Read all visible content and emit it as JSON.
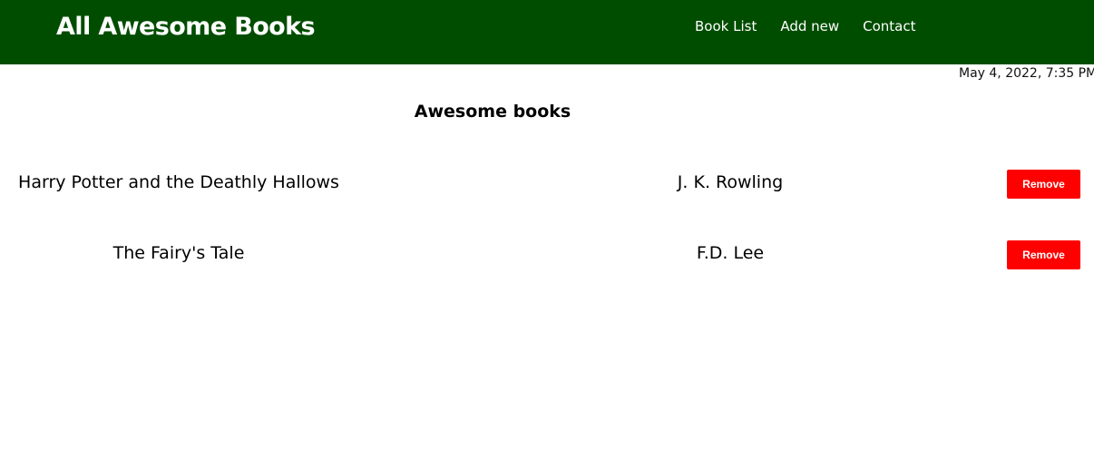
{
  "header": {
    "brand": "All Awesome Books",
    "nav": [
      {
        "label": "Book List"
      },
      {
        "label": "Add new"
      },
      {
        "label": "Contact"
      }
    ],
    "background_color": "#004d00"
  },
  "timestamp": "May 4, 2022, 7:35 PM",
  "main": {
    "title": "Awesome books",
    "books": [
      {
        "title": "Harry Potter and the Deathly Hallows",
        "author": "J. K. Rowling",
        "remove_label": "Remove"
      },
      {
        "title": "The Fairy's Tale",
        "author": "F.D. Lee",
        "remove_label": "Remove"
      }
    ],
    "remove_button_color": "#ff0000"
  }
}
